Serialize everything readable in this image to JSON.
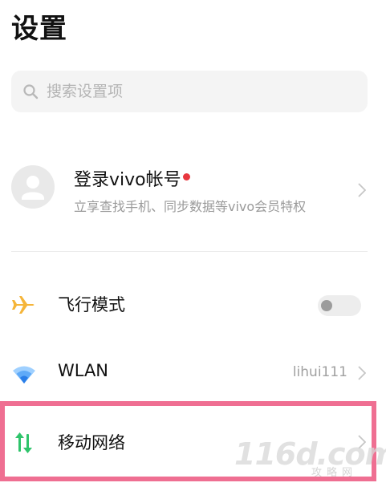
{
  "header": {
    "title": "设置"
  },
  "search": {
    "placeholder": "搜索设置项",
    "icon": "search-icon"
  },
  "account": {
    "title": "登录vivo帐号",
    "subtitle": "立享查找手机、同步数据等vivo会员特权",
    "has_notification_dot": true,
    "icon": "user-avatar-icon"
  },
  "settings": [
    {
      "label": "飞行模式",
      "icon": "airplane-icon",
      "icon_color": "#f5b53a",
      "control": "toggle",
      "toggle_on": false
    },
    {
      "label": "WLAN",
      "icon": "wifi-icon",
      "icon_color": "#3e8ff2",
      "value": "lihui111",
      "control": "chevron"
    },
    {
      "label": "移动网络",
      "icon": "mobile-data-icon",
      "icon_color": "#2fc46b",
      "control": "chevron",
      "highlighted": true
    }
  ],
  "colors": {
    "highlight_border": "#ef6f92",
    "notification_dot": "#e8373f",
    "secondary_text": "#9a9a9a"
  },
  "watermark": {
    "main": "116d.com",
    "sub": "攻略网"
  }
}
